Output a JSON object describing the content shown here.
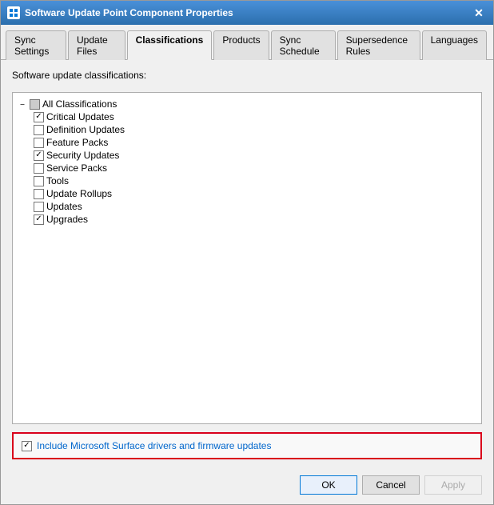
{
  "window": {
    "title": "Software Update Point Component Properties",
    "icon": "settings-icon"
  },
  "tabs": [
    {
      "label": "Sync Settings",
      "active": false
    },
    {
      "label": "Update Files",
      "active": false
    },
    {
      "label": "Classifications",
      "active": true
    },
    {
      "label": "Products",
      "active": false
    },
    {
      "label": "Sync Schedule",
      "active": false
    },
    {
      "label": "Supersedence Rules",
      "active": false
    },
    {
      "label": "Languages",
      "active": false
    }
  ],
  "section_label": "Software update classifications:",
  "tree": {
    "root": {
      "label": "All Classifications",
      "checked": "partial"
    },
    "items": [
      {
        "label": "Critical Updates",
        "checked": true
      },
      {
        "label": "Definition Updates",
        "checked": false
      },
      {
        "label": "Feature Packs",
        "checked": false
      },
      {
        "label": "Security Updates",
        "checked": true
      },
      {
        "label": "Service Packs",
        "checked": false
      },
      {
        "label": "Tools",
        "checked": false
      },
      {
        "label": "Update Rollups",
        "checked": false
      },
      {
        "label": "Updates",
        "checked": false
      },
      {
        "label": "Upgrades",
        "checked": true
      }
    ]
  },
  "surface": {
    "checked": true,
    "label_plain": "Include Microsoft Surface drivers ",
    "label_link": "and firmware updates"
  },
  "buttons": {
    "ok": "OK",
    "cancel": "Cancel",
    "apply": "Apply"
  }
}
